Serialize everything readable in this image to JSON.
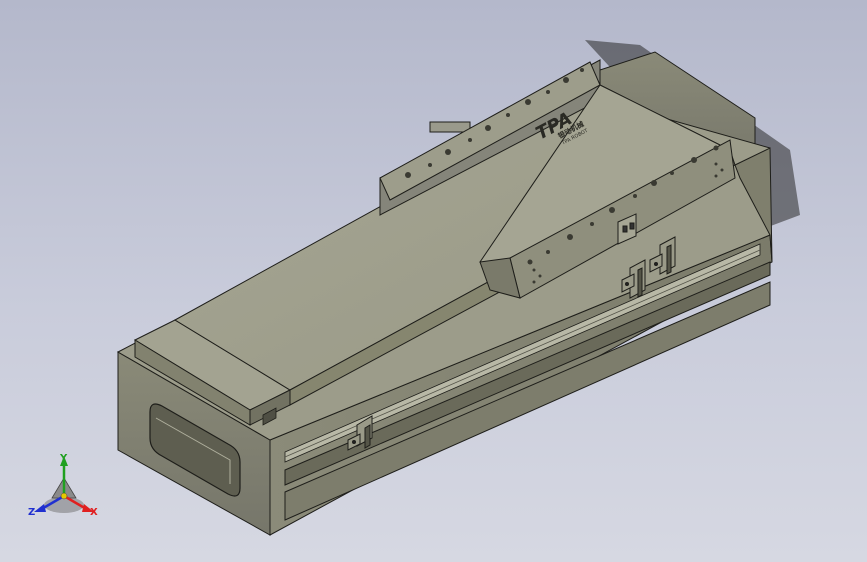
{
  "model": {
    "brand_logo": "TPA",
    "brand_chinese": "银动机械",
    "brand_english": "TPA ROBOT",
    "colors": {
      "background_top": "#b4b8cb",
      "background_bottom": "#d6d8e2",
      "body_light": "#a6a694",
      "body_mid": "#8e8e7c",
      "body_dark": "#6d6d5d",
      "edge": "#1e1e1a"
    }
  },
  "triad": {
    "x_label": "X",
    "y_label": "Y",
    "z_label": "Z",
    "x_color": "#e02020",
    "y_color": "#20a020",
    "z_color": "#2030d0"
  }
}
